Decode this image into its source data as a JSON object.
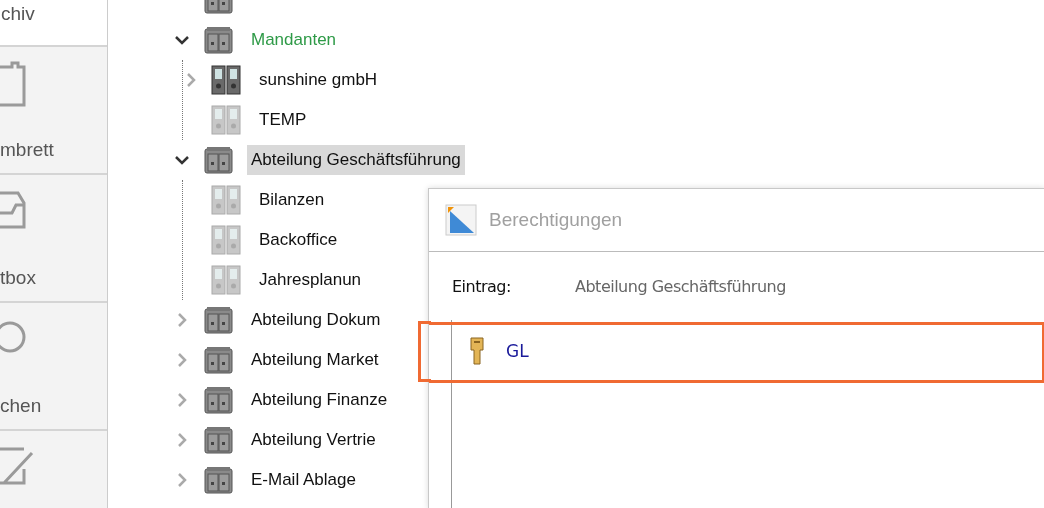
{
  "sidebar": {
    "header": "chiv",
    "items": [
      {
        "label": "mbrett",
        "kind": "clipboard"
      },
      {
        "label": "tbox",
        "kind": "tray"
      },
      {
        "label": "chen",
        "kind": "search"
      },
      {
        "kind": "edit"
      }
    ]
  },
  "tree": {
    "nodes": [
      {
        "kind": "cabinet",
        "selected": false
      },
      {
        "label": "Mandanten",
        "kind": "cabinet",
        "color": "#2e9a47",
        "expanded": true,
        "selected": false,
        "children": [
          {
            "label": "sunshine gmbH",
            "kind": "binder",
            "expanded": false,
            "selected": false
          },
          {
            "label": "TEMP",
            "kind": "binder-faded",
            "selected": false
          }
        ]
      },
      {
        "label": "Abteilung Geschäftsführung",
        "kind": "cabinet",
        "expanded": true,
        "selected": true,
        "children": [
          {
            "label": "Bilanzen",
            "kind": "binder-faded",
            "selected": false
          },
          {
            "label": "Backoffice",
            "kind": "binder-faded",
            "selected": false
          },
          {
            "label": "Jahresplanun",
            "kind": "binder-faded",
            "selected": false
          }
        ]
      },
      {
        "label": "Abteilung Dokum",
        "kind": "cabinet",
        "expanded": false,
        "selected": false
      },
      {
        "label": "Abteilung Market",
        "kind": "cabinet",
        "expanded": false,
        "selected": false
      },
      {
        "label": "Abteilung Finanze",
        "kind": "cabinet",
        "expanded": false,
        "selected": false
      },
      {
        "label": "Abteilung Vertrie",
        "kind": "cabinet",
        "expanded": false,
        "selected": false
      },
      {
        "label": "E-Mail Ablage",
        "kind": "cabinet",
        "expanded": false,
        "selected": false
      }
    ]
  },
  "dialog": {
    "title": "Berechtigungen",
    "entry_label": "Eintrag:",
    "entry_value": "Abteilung Geschäftsführung",
    "permissions": [
      {
        "label": "GL",
        "highlighted": true
      }
    ]
  }
}
